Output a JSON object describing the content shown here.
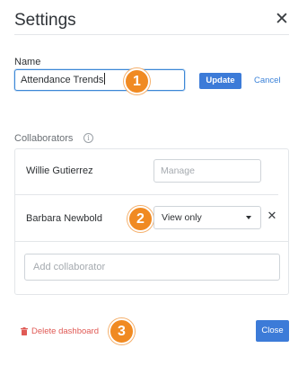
{
  "header": {
    "title": "Settings"
  },
  "name_section": {
    "label": "Name",
    "input_value": "Attendance Trends",
    "update_label": "Update",
    "cancel_label": "Cancel"
  },
  "collaborators": {
    "label": "Collaborators",
    "info_glyph": "i",
    "rows": [
      {
        "name": "Willie Gutierrez",
        "permission_placeholder": "Manage"
      },
      {
        "name": "Barbara Newbold",
        "permission_value": "View only"
      }
    ],
    "add_placeholder": "Add collaborator"
  },
  "footer": {
    "delete_label": "Delete dashboard",
    "close_label": "Close"
  },
  "badges": [
    "1",
    "2",
    "3"
  ],
  "colors": {
    "accent": "#3c7bd8",
    "badge": "#f08a22",
    "danger": "#e05a55"
  },
  "icons": {
    "dialog_close": "close-icon",
    "info": "info-icon",
    "remove": "remove-icon",
    "trash": "trash-icon",
    "select_caret": "chevron-down-icon"
  }
}
